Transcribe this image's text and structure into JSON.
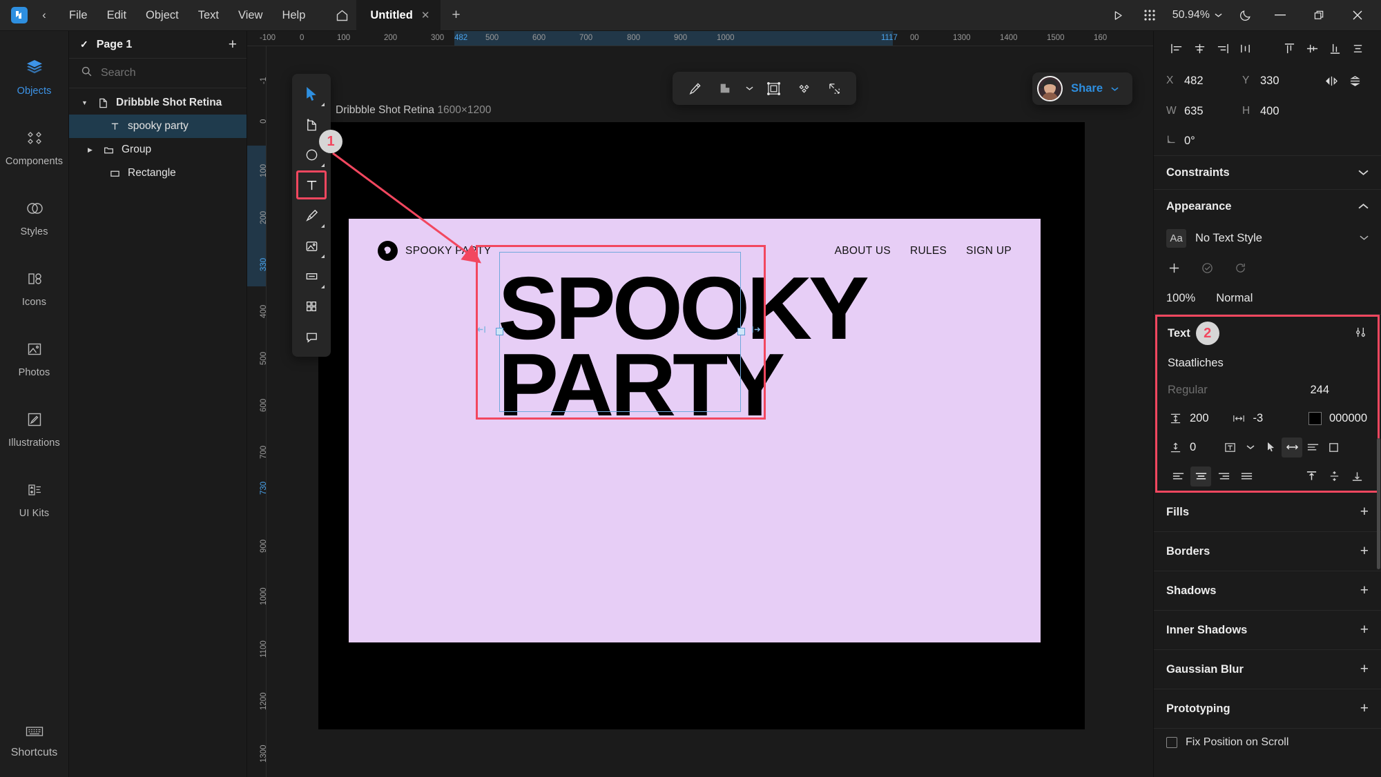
{
  "app": {
    "logo_icon": "lunacy-logo-icon",
    "back_icon": "chevron-left-icon",
    "menus": [
      "File",
      "Edit",
      "Object",
      "Text",
      "View",
      "Help"
    ],
    "home_icon": "home-icon",
    "tab": {
      "title": "Untitled",
      "close_icon": "close-icon"
    },
    "new_tab_icon": "plus-icon",
    "present_icon": "play-icon",
    "apps_icon": "grid-apps-icon",
    "zoom_level": "50.94%",
    "zoom_chevron_icon": "chevron-down-icon",
    "theme_icon": "moon-icon",
    "minimize_icon": "minimize-icon",
    "maximize_icon": "restore-icon",
    "close_icon": "close-icon"
  },
  "rail": {
    "items": [
      {
        "label": "Objects",
        "icon": "layers-icon",
        "active": true
      },
      {
        "label": "Components",
        "icon": "components-icon",
        "active": false
      },
      {
        "label": "Styles",
        "icon": "styles-icon",
        "active": false
      },
      {
        "label": "Icons",
        "icon": "icons-icon",
        "active": false
      },
      {
        "label": "Photos",
        "icon": "photos-icon",
        "active": false
      },
      {
        "label": "Illustrations",
        "icon": "illustrations-icon",
        "active": false
      },
      {
        "label": "UI Kits",
        "icon": "uikits-icon",
        "active": false
      }
    ],
    "bottom": {
      "label": "Shortcuts",
      "icon": "keyboard-icon"
    }
  },
  "layers": {
    "page_label": "Page 1",
    "page_check_icon": "check-icon",
    "add_page_icon": "plus-icon",
    "search": {
      "placeholder": "Search",
      "value": "",
      "icon": "search-icon",
      "collapse_icon": "collapse-all-icon"
    },
    "tree": [
      {
        "label": "Dribbble Shot Retina",
        "icon": "artboard-icon",
        "indent": 0,
        "twisty": "down",
        "selected": false,
        "bold": true
      },
      {
        "label": "spooky party",
        "icon": "text-layer-icon",
        "indent": 1,
        "twisty": "none",
        "selected": true,
        "bold": false
      },
      {
        "label": "Group",
        "icon": "folder-icon",
        "indent": 1,
        "twisty": "right",
        "selected": false,
        "bold": false
      },
      {
        "label": "Rectangle",
        "icon": "rectangle-icon",
        "indent": 1,
        "twisty": "none",
        "selected": false,
        "bold": false
      }
    ]
  },
  "tools": {
    "items": [
      {
        "name": "select-tool",
        "icon": "cursor-icon",
        "active": true,
        "submenu": true,
        "highlight": false
      },
      {
        "name": "artboard-tool",
        "icon": "artboard-add-icon",
        "active": false,
        "submenu": true,
        "highlight": false
      },
      {
        "name": "shape-tool",
        "icon": "ellipse-icon",
        "active": false,
        "submenu": true,
        "highlight": false
      },
      {
        "name": "text-tool",
        "icon": "text-T-icon",
        "active": false,
        "submenu": false,
        "highlight": true
      },
      {
        "name": "pen-tool",
        "icon": "pen-icon",
        "active": false,
        "submenu": true,
        "highlight": false
      },
      {
        "name": "image-tool",
        "icon": "image-icon",
        "active": false,
        "submenu": true,
        "highlight": false
      },
      {
        "name": "input-tool",
        "icon": "input-field-icon",
        "active": false,
        "submenu": true,
        "highlight": false
      },
      {
        "name": "components-tool",
        "icon": "grid-four-icon",
        "active": false,
        "submenu": false,
        "highlight": false
      },
      {
        "name": "comment-tool",
        "icon": "comment-icon",
        "active": false,
        "submenu": false,
        "highlight": false
      }
    ]
  },
  "canvas_toolbar": {
    "items": [
      {
        "name": "edit-tool",
        "icon": "pencil-icon"
      },
      {
        "name": "boolean-tool",
        "icon": "boolean-union-icon"
      },
      {
        "name": "boolean-chevron",
        "icon": "chevron-down-icon"
      },
      {
        "name": "mask-tool",
        "icon": "mask-icon"
      },
      {
        "name": "make-component",
        "icon": "component-diamond-icon"
      },
      {
        "name": "export-tool",
        "icon": "export-icon"
      }
    ]
  },
  "share": {
    "label": "Share",
    "chevron_icon": "chevron-down-icon",
    "avatar_icon": "user-avatar"
  },
  "artboard": {
    "name": "Dribbble Shot Retina",
    "size": "1600×1200",
    "background": "#e7cef6",
    "design": {
      "brand_name": "SPOOKY PARTY",
      "brand_logo_icon": "ghost-icon",
      "links": [
        "ABOUT US",
        "RULES",
        "SIGN UP"
      ],
      "headline": "SPOOKY\nPARTY"
    }
  },
  "annotations": [
    {
      "number": "1",
      "target": "text-tool"
    },
    {
      "number": "2",
      "target": "text-section"
    }
  ],
  "rulers": {
    "horizontal": [
      "-100",
      "0",
      "100",
      "200",
      "300",
      "482",
      "500",
      "600",
      "700",
      "800",
      "900",
      "1000",
      "1117",
      "00",
      "1300",
      "1400",
      "1500",
      "160"
    ],
    "horizontal_highlight": [
      "482",
      "1117"
    ],
    "vertical": [
      "-1",
      "0",
      "100",
      "200",
      "330",
      "400",
      "500",
      "600",
      "700",
      "730",
      "900",
      "1000",
      "1100",
      "1200",
      "1300"
    ],
    "vertical_highlight": [
      "330",
      "730"
    ]
  },
  "inspector": {
    "align_left_group": [
      {
        "name": "align-left-button",
        "icon": "align-left-icon"
      },
      {
        "name": "align-center-h-button",
        "icon": "align-center-h-icon"
      },
      {
        "name": "align-right-button",
        "icon": "align-right-icon"
      },
      {
        "name": "distribute-h-button",
        "icon": "distribute-h-icon"
      }
    ],
    "align_right_group": [
      {
        "name": "align-top-button",
        "icon": "align-top-icon"
      },
      {
        "name": "align-middle-button",
        "icon": "align-middle-icon"
      },
      {
        "name": "align-bottom-button",
        "icon": "align-bottom-icon"
      },
      {
        "name": "distribute-v-button",
        "icon": "distribute-v-icon"
      }
    ],
    "geometry": {
      "x_label": "X",
      "x_value": "482",
      "y_label": "Y",
      "y_value": "330",
      "w_label": "W",
      "w_value": "635",
      "h_label": "H",
      "h_value": "400",
      "rotation_label": "rotation-icon",
      "rotation_value": "0°",
      "flip_h_icon": "flip-horizontal-icon",
      "flip_v_icon": "flip-vertical-icon"
    },
    "constraints": {
      "title": "Constraints",
      "chevron": "chevron-down-icon"
    },
    "appearance": {
      "title": "Appearance",
      "chevron": "chevron-up-icon",
      "text_style": "No Text Style",
      "text_style_icon": "Aa",
      "style_chevron": "chevron-down-icon",
      "actions": [
        {
          "name": "add-style-button",
          "icon": "plus-icon"
        },
        {
          "name": "confirm-style-button",
          "icon": "check-circle-icon"
        },
        {
          "name": "reset-style-button",
          "icon": "reset-icon"
        }
      ],
      "opacity": "100%",
      "blend_mode": "Normal"
    },
    "text": {
      "title": "Text",
      "settings_icon": "sliders-icon",
      "font_family": "Staatliches",
      "font_weight": "Regular",
      "font_size": "244",
      "line_height_icon": "line-height-icon",
      "line_height": "200",
      "letter_spacing_icon": "letter-spacing-icon",
      "letter_spacing": "-3",
      "color_hex": "000000",
      "paragraph_icon": "paragraph-spacing-icon",
      "paragraph_spacing": "0",
      "resize_icon": "text-resize-icon",
      "resize_chevron": "chevron-down-icon",
      "cursor_icon": "cursor-small-icon",
      "auto_width_icon": "auto-width-icon",
      "auto_height_icon": "auto-height-icon",
      "fixed_size_icon": "fixed-size-icon",
      "align_buttons": [
        {
          "name": "text-align-left-button",
          "icon": "text-align-left-icon",
          "active": false
        },
        {
          "name": "text-align-center-button",
          "icon": "text-align-center-icon",
          "active": true
        },
        {
          "name": "text-align-right-button",
          "icon": "text-align-right-icon",
          "active": false
        },
        {
          "name": "text-align-justify-button",
          "icon": "text-align-justify-icon",
          "active": false
        }
      ],
      "valign_buttons": [
        {
          "name": "text-valign-top-button",
          "icon": "valign-top-icon",
          "active": true
        },
        {
          "name": "text-valign-middle-button",
          "icon": "valign-middle-icon",
          "active": false
        },
        {
          "name": "text-valign-bottom-button",
          "icon": "valign-bottom-icon",
          "active": false
        }
      ]
    },
    "sections": [
      {
        "title": "Fills",
        "action": "plus-icon"
      },
      {
        "title": "Borders",
        "action": "plus-icon"
      },
      {
        "title": "Shadows",
        "action": "plus-icon"
      },
      {
        "title": "Inner Shadows",
        "action": "plus-icon"
      },
      {
        "title": "Gaussian Blur",
        "action": "plus-icon"
      },
      {
        "title": "Prototyping",
        "action": "plus-icon"
      }
    ],
    "fix_position": "Fix Position on Scroll"
  },
  "colors": {
    "accent": "#2e8fe0",
    "highlight_red": "#f2475f",
    "selection_blue": "#1f3b4d",
    "canvas_bg": "#1b1b1b",
    "panel_bg": "#1b1b1b",
    "artboard_bg": "#e7cef6"
  }
}
